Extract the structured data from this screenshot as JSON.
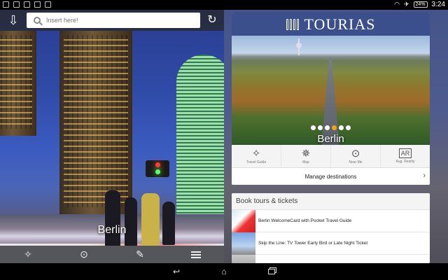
{
  "status_bar": {
    "battery": "24%",
    "time": "3:24"
  },
  "left": {
    "search": {
      "placeholder": "Insert here!",
      "value": ""
    },
    "caption": "Berlin"
  },
  "right": {
    "brand": "TOURIAS",
    "destination": {
      "name": "Berlin",
      "pager": {
        "count": 6,
        "active_index": 3
      }
    },
    "tools": [
      {
        "icon": "compass-star-icon",
        "label": "Travel Guide"
      },
      {
        "icon": "map-compass-icon",
        "label": "Map"
      },
      {
        "icon": "near-me-icon",
        "label": "Near Me"
      },
      {
        "icon": "ar-icon",
        "label": "Aug. Reality"
      }
    ],
    "manage_label": "Manage destinations",
    "tours": {
      "title": "Book tours & tickets",
      "items": [
        {
          "text": "Berlin WelcomeCard with Pocket Travel Guide"
        },
        {
          "text": "Skip the Line: TV Tower Early Bird or Late Night Ticket"
        },
        {
          "text": ""
        }
      ]
    }
  },
  "colors": {
    "header_blue": "#3b4f8c",
    "pager_active": "#f3a21a",
    "bottom_bar": "#55565b"
  }
}
